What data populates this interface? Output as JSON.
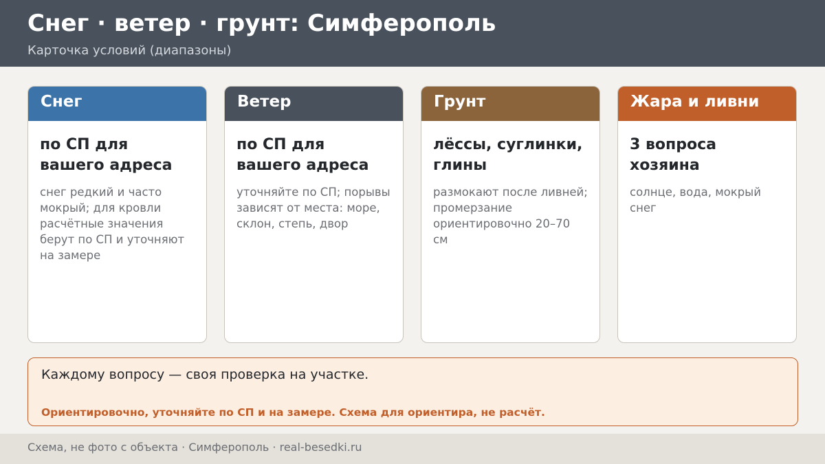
{
  "header": {
    "title": "Снег · ветер · грунт: Симферополь",
    "subtitle": "Карточка условий (диапазоны)"
  },
  "cards": [
    {
      "label": "Снег",
      "color": "#3c73a8",
      "value": "по СП для вашего адреса",
      "note": "снег редкий и часто мокрый; для кровли расчётные значения берут по СП и уточняют на замере"
    },
    {
      "label": "Ветер",
      "color": "#48515c",
      "value": "по СП для вашего адреса",
      "note": "уточняйте по СП; порывы зависят от места: море, склон, степь, двор"
    },
    {
      "label": "Грунт",
      "color": "#8c643c",
      "value": "лёссы, суглинки, глины",
      "note": "размокают после ливней; промерзание ориентировочно 20–70 см"
    },
    {
      "label": "Жара и ливни",
      "color": "#c15f2b",
      "value": "3 вопроса хозяина",
      "note": "солнце, вода, мокрый снег"
    }
  ],
  "note": {
    "main": "Каждому вопросу — своя проверка на участке.",
    "warning": "Ориентировочно, уточняйте по СП и на замере. Схема для ориентира, не расчёт."
  },
  "footer": {
    "text": "Схема, не фото с объекта  ·  Симферополь  ·  real-besedki.ru"
  }
}
